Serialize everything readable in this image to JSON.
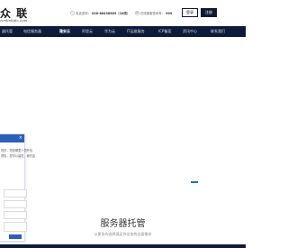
{
  "brand": {
    "name": "众 联",
    "url": "zonlinkidc.com"
  },
  "header": {
    "phone_label": "电话咨询：",
    "phone_number": "028-86436609（10线）",
    "online_label": "在线客服咨询号：",
    "online_number": "909",
    "login_label": "登录",
    "register_label": "注册"
  },
  "nav": {
    "items": [
      {
        "label": "器托管"
      },
      {
        "label": "电信服务器"
      },
      {
        "label": "雅安云"
      },
      {
        "label": "阿里云"
      },
      {
        "label": "华为云"
      },
      {
        "label": "IT运维服务"
      },
      {
        "label": "ICP备案"
      },
      {
        "label": "资讯中心"
      },
      {
        "label": "联系我们"
      }
    ]
  },
  "chat": {
    "line1": "您好，您是哪里人员外包",
    "line2": "项目，您可以留言，我们会"
  },
  "section": {
    "title": "服务器托管",
    "subtitle": "以更多的选择满足你业务的全面需求"
  },
  "colors": {
    "nav_bg": "#0d1b3a",
    "accent": "#1a73c8",
    "chat_header": "#2b5fb8"
  }
}
